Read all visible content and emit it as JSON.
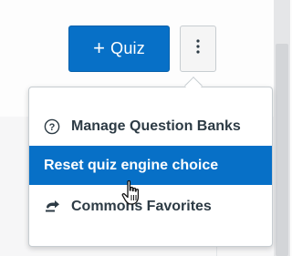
{
  "toolbar": {
    "add_quiz_button": {
      "plus": "+",
      "label": "Quiz"
    },
    "more_options_icon": "vertical-ellipsis-icon"
  },
  "menu": {
    "items": [
      {
        "label": "Manage Question Banks",
        "icon": "question-circle-icon",
        "active": false
      },
      {
        "label": "Reset quiz engine choice",
        "icon": "",
        "active": true
      },
      {
        "label": "Commons Favorites",
        "icon": "commons-share-icon",
        "active": false
      }
    ]
  },
  "colors": {
    "primary": "#0770c7",
    "text": "#2d3b45",
    "border": "#c7cdd1"
  },
  "cursor": "hand-pointer-icon"
}
